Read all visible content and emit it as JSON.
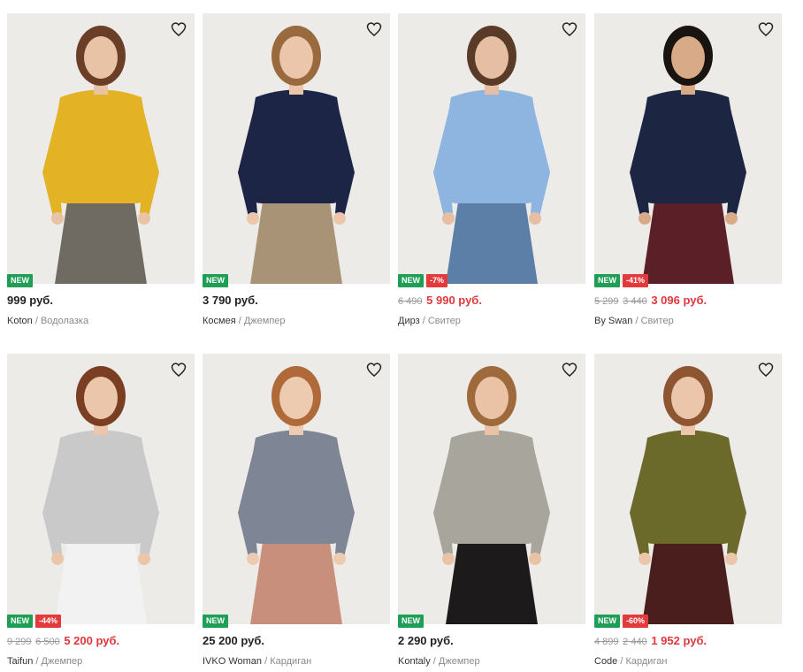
{
  "products": [
    {
      "brand": "Koton",
      "category": "Водолазка",
      "price": "999 руб.",
      "new": "NEW",
      "discount": "",
      "old_price": "",
      "old_price2": "",
      "colors": {
        "bg": "#ecebe8",
        "top": "#e3b325",
        "bottom": "#6f6a62",
        "hair": "#6b3f27",
        "skin": "#e8c3a6"
      }
    },
    {
      "brand": "Космея",
      "category": "Джемпер",
      "price": "3 790 руб.",
      "new": "NEW",
      "discount": "",
      "old_price": "",
      "old_price2": "",
      "colors": {
        "bg": "#ecebe8",
        "top": "#1d2547",
        "bottom": "#a89377",
        "hair": "#9a6a3f",
        "skin": "#ebc6ab"
      }
    },
    {
      "brand": "Дирз",
      "category": "Свитер",
      "price": "5 990 руб.",
      "new": "NEW",
      "discount": "-7%",
      "old_price": "6 490",
      "old_price2": "",
      "colors": {
        "bg": "#ecebe8",
        "top": "#8db5e0",
        "bottom": "#5c7fa8",
        "hair": "#5a3b27",
        "skin": "#e6bea3"
      }
    },
    {
      "brand": "By Swan",
      "category": "Свитер",
      "price": "3 096 руб.",
      "new": "NEW",
      "discount": "-41%",
      "old_price": "5 299",
      "old_price2": "3 440",
      "colors": {
        "bg": "#ecebe8",
        "top": "#1c2542",
        "bottom": "#5a1f27",
        "hair": "#1a1410",
        "skin": "#d9aa88"
      }
    },
    {
      "brand": "Taifun",
      "category": "Джемпер",
      "price": "5 200 руб.",
      "new": "NEW",
      "discount": "-44%",
      "old_price": "9 299",
      "old_price2": "6 500",
      "colors": {
        "bg": "#ecebe8",
        "top": "#c9c9c9",
        "bottom": "#f2f2f2",
        "hair": "#7a3f22",
        "skin": "#ecc6ab"
      }
    },
    {
      "brand": "IVKO Woman",
      "category": "Кардиган",
      "price": "25 200 руб.",
      "new": "NEW",
      "discount": "",
      "old_price": "",
      "old_price2": "",
      "colors": {
        "bg": "#ecebe8",
        "top": "#7e8595",
        "bottom": "#c98f7d",
        "hair": "#b06a3a",
        "skin": "#edcbb0"
      }
    },
    {
      "brand": "Kontaly",
      "category": "Джемпер",
      "price": "2 290 руб.",
      "new": "NEW",
      "discount": "",
      "old_price": "",
      "old_price2": "",
      "colors": {
        "bg": "#ecebe8",
        "top": "#a7a59c",
        "bottom": "#1c1a1a",
        "hair": "#9e6a3c",
        "skin": "#eac3a6"
      }
    },
    {
      "brand": "Code",
      "category": "Кардиган",
      "price": "1 952 руб.",
      "new": "NEW",
      "discount": "-60%",
      "old_price": "4 899",
      "old_price2": "2 440",
      "colors": {
        "bg": "#ecebe8",
        "top": "#6b6a2a",
        "bottom": "#4a1e1c",
        "hair": "#8e5532",
        "skin": "#ecc6aa"
      }
    }
  ],
  "icons": {
    "favorite": "heart-outline-icon"
  },
  "separator": "/",
  "accent_colors": {
    "new_badge": "#1f9e55",
    "discount_badge": "#e33b3b",
    "sale_price": "#e0383d"
  }
}
